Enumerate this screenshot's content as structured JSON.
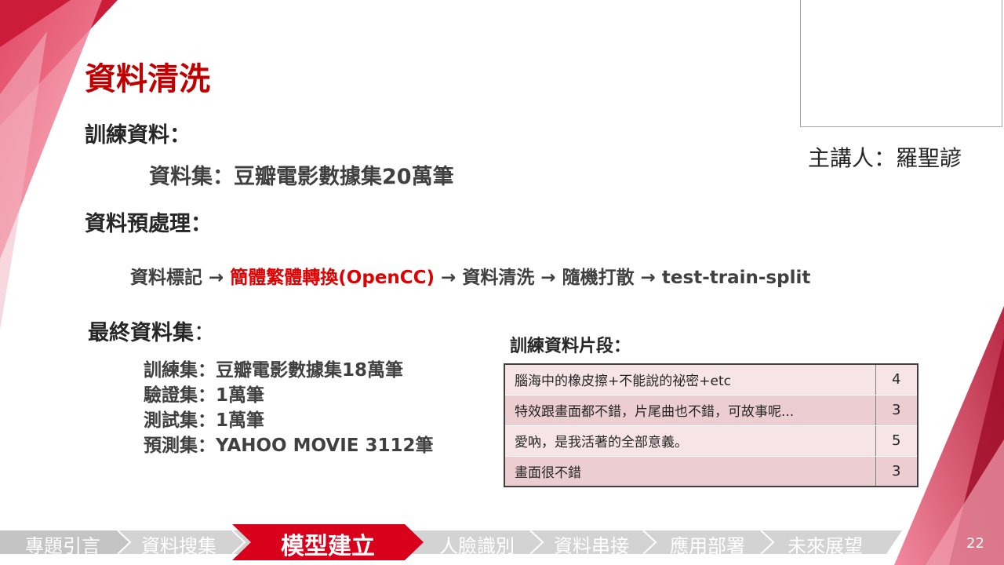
{
  "slide": {
    "title": "資料清洗",
    "speaker": "主講人：羅聖諺",
    "page_number": "22"
  },
  "training": {
    "heading": "訓練資料：",
    "dataset": "資料集：豆瓣電影數據集20萬筆"
  },
  "preprocess": {
    "heading": "資料預處理：",
    "step_1": "資料標記 → ",
    "step_highlight": "簡體繁體轉換(OpenCC)",
    "step_rest": " → 資料清洗 → 隨機打散 → test-train-split"
  },
  "final": {
    "heading": "最終資料集",
    "colon": "：",
    "items": [
      "訓練集：豆瓣電影數據集18萬筆",
      "驗證集：1萬筆",
      "測試集：1萬筆",
      "預測集：YAHOO MOVIE 3112筆"
    ]
  },
  "sample": {
    "heading": "訓練資料片段：",
    "rows": [
      {
        "text": "腦海中的橡皮擦+不能說的祕密+etc",
        "score": "4"
      },
      {
        "text": "特效跟畫面都不錯，片尾曲也不錯，可故事呢...",
        "score": "3"
      },
      {
        "text": "愛吶，是我活著的全部意義。",
        "score": "5"
      },
      {
        "text": "畫面很不錯",
        "score": "3"
      }
    ]
  },
  "nav": {
    "items": [
      "專題引言",
      "資料搜集",
      "模型建立",
      "人臉識別",
      "資料串接",
      "應用部署",
      "未來展望"
    ],
    "active": "模型建立"
  },
  "colors": {
    "accent": "#c00000",
    "highlight": "#e00000",
    "nav_bg": "#c4c4c4",
    "nav_active": "#d9001b",
    "row_light": "#f6e4e6",
    "row_dark": "#ecced2"
  }
}
